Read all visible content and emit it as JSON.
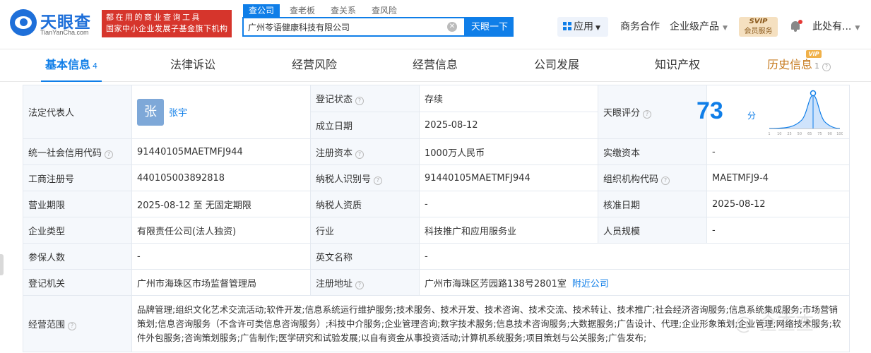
{
  "header": {
    "logo_text": "天眼查",
    "logo_sub": "TianYanCha.com",
    "banner_line1": "都在用的商业查询工具",
    "banner_line2": "国家中小企业发展子基金旗下机构",
    "search_tabs": [
      "查公司",
      "查老板",
      "查关系",
      "查风险"
    ],
    "search_value": "广州苓语健康科技有限公司",
    "search_button": "天眼一下",
    "app_label": "应用",
    "nav_business": "商务合作",
    "nav_enterprise": "企业级产品",
    "svip_top": "SVIP",
    "svip_bottom": "会员服务",
    "user_name": "此处有..."
  },
  "tabs": {
    "basic": "基本信息",
    "basic_count": "4",
    "legal": "法律诉讼",
    "risk": "经营风险",
    "ops": "经营信息",
    "dev": "公司发展",
    "ip": "知识产权",
    "history": "历史信息",
    "history_count": "1",
    "vip": "VIP"
  },
  "info": {
    "legal_rep_label": "法定代表人",
    "legal_rep_avatar": "张",
    "legal_rep_name": "张宇",
    "reg_status_label": "登记状态",
    "reg_status": "存续",
    "score_label": "天眼评分",
    "score_value": "73",
    "score_unit": "分",
    "found_date_label": "成立日期",
    "found_date": "2025-08-12",
    "credit_code_label": "统一社会信用代码",
    "credit_code": "91440105MAETMFJ944",
    "reg_capital_label": "注册资本",
    "reg_capital": "1000万人民币",
    "paid_capital_label": "实缴资本",
    "paid_capital": "-",
    "biz_reg_no_label": "工商注册号",
    "biz_reg_no": "440105003892818",
    "taxpayer_id_label": "纳税人识别号",
    "taxpayer_id": "91440105MAETMFJ944",
    "org_code_label": "组织机构代码",
    "org_code": "MAETMFJ9-4",
    "biz_term_label": "营业期限",
    "biz_term": "2025-08-12 至 无固定期限",
    "taxpayer_quality_label": "纳税人资质",
    "taxpayer_quality": "-",
    "approve_date_label": "核准日期",
    "approve_date": "2025-08-12",
    "company_type_label": "企业类型",
    "company_type": "有限责任公司(法人独资)",
    "industry_label": "行业",
    "industry": "科技推广和应用服务业",
    "staff_size_label": "人员规模",
    "staff_size": "-",
    "insured_label": "参保人数",
    "insured": "-",
    "english_name_label": "英文名称",
    "english_name": "-",
    "reg_authority_label": "登记机关",
    "reg_authority": "广州市海珠区市场监督管理局",
    "reg_address_label": "注册地址",
    "reg_address": "广州市海珠区芳园路138号2801室",
    "nearby_link": "附近公司",
    "scope_label": "经营范围",
    "scope_text": "品牌管理;组织文化艺术交流活动;软件开发;信息系统运行维护服务;技术服务、技术开发、技术咨询、技术交流、技术转让、技术推广;社会经济咨询服务;信息系统集成服务;市场营销策划;信息咨询服务（不含许可类信息咨询服务）;科技中介服务;企业管理咨询;数字技术服务;信息技术咨询服务;大数据服务;广告设计、代理;企业形象策划;企业管理;网络技术服务;软件外包服务;咨询策划服务;广告制作;医学研究和试验发展;以自有资金从事投资活动;计算机系统服务;项目策划与公关服务;广告发布;"
  },
  "score_chart_ticks": [
    "1",
    "10",
    "25",
    "50",
    "65",
    "75",
    "90",
    "100"
  ],
  "colors": {
    "primary": "#0f7ee8",
    "banner": "#d6352c",
    "status_green": "#1ba36f",
    "history": "#c67a1e"
  }
}
